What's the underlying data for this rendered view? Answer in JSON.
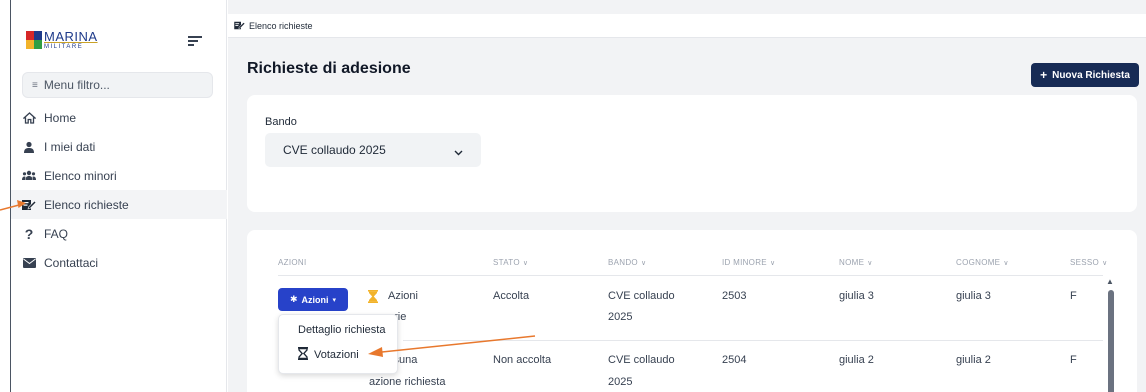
{
  "sidebar": {
    "logo_main": "MARINA",
    "logo_sub": "MILITARE",
    "filter_placeholder": "Menu filtro...",
    "items": [
      {
        "label": "Home",
        "icon": "home-icon"
      },
      {
        "label": "I miei dati",
        "icon": "user-icon"
      },
      {
        "label": "Elenco minori",
        "icon": "users-icon"
      },
      {
        "label": "Elenco richieste",
        "icon": "edit-list-icon",
        "active": true
      },
      {
        "label": "FAQ",
        "icon": "question-icon"
      },
      {
        "label": "Contattaci",
        "icon": "envelope-icon"
      }
    ]
  },
  "breadcrumb": "Elenco richieste",
  "page_title": "Richieste di adesione",
  "new_button": "Nuova Richiesta",
  "filter": {
    "label": "Bando",
    "selected": "CVE collaudo 2025"
  },
  "table": {
    "headers": [
      "AZIONI",
      "STATO",
      "BANDO",
      "ID MINORE",
      "NOME",
      "COGNOME",
      "SESSO"
    ],
    "actions_button": "Azioni",
    "rows": [
      {
        "azioni_text_1": "Azioni",
        "azioni_text_2": "arie",
        "stato": "Accolta",
        "bando_1": "CVE collaudo",
        "bando_2": "2025",
        "id": "2503",
        "nome": "giulia 3",
        "cognome": "giulia 3",
        "sesso": "F"
      },
      {
        "azioni_text_1": "ssuna",
        "azioni_text_2": "azione richiesta",
        "stato": "Non accolta",
        "bando_1": "CVE collaudo",
        "bando_2": "2025",
        "id": "2504",
        "nome": "giulia 2",
        "cognome": "giulia 2",
        "sesso": "F"
      }
    ],
    "dropdown": [
      "Dettaglio richiesta",
      "Votazioni"
    ]
  },
  "colors": {
    "primary_button": "#2742c9",
    "new_button": "#172b55",
    "annotation_arrow": "#e8782d",
    "pending_icon": "#f2b32a"
  }
}
